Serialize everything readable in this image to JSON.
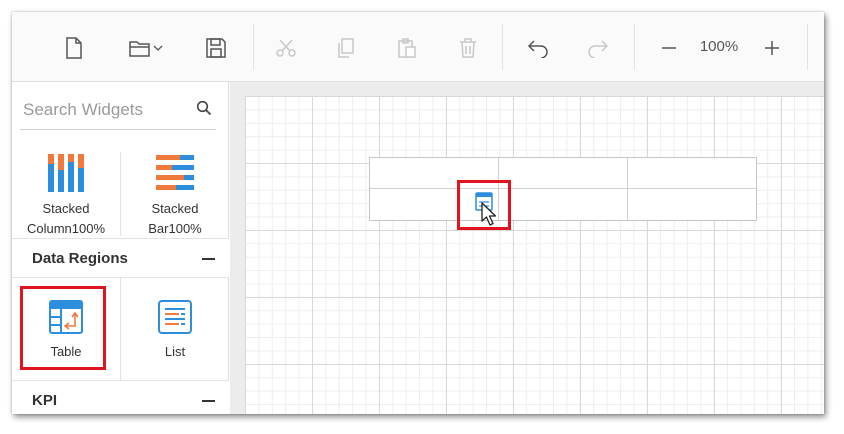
{
  "toolbar": {
    "items": [
      "new-file",
      "open-folder",
      "save",
      "cut",
      "copy",
      "paste",
      "delete",
      "undo",
      "redo",
      "zoom-out",
      "zoom-in"
    ],
    "zoom_level": "100%"
  },
  "sidebar": {
    "search": {
      "placeholder": "Search Widgets",
      "value": ""
    },
    "widgets_top": [
      {
        "line1": "Stacked",
        "line2": "Column100%",
        "icon": "stacked-column-100-icon"
      },
      {
        "line1": "Stacked",
        "line2": "Bar100%",
        "icon": "stacked-bar-100-icon"
      }
    ],
    "data_regions": {
      "title": "Data Regions",
      "items": [
        {
          "label": "Table",
          "icon": "table-icon",
          "highlighted": true
        },
        {
          "label": "List",
          "icon": "list-icon",
          "highlighted": false
        }
      ]
    },
    "kpi": {
      "title": "KPI"
    }
  },
  "colors": {
    "accent_blue": "#2e8ede",
    "accent_orange": "#f07a3c",
    "highlight_red": "#e0141e"
  }
}
